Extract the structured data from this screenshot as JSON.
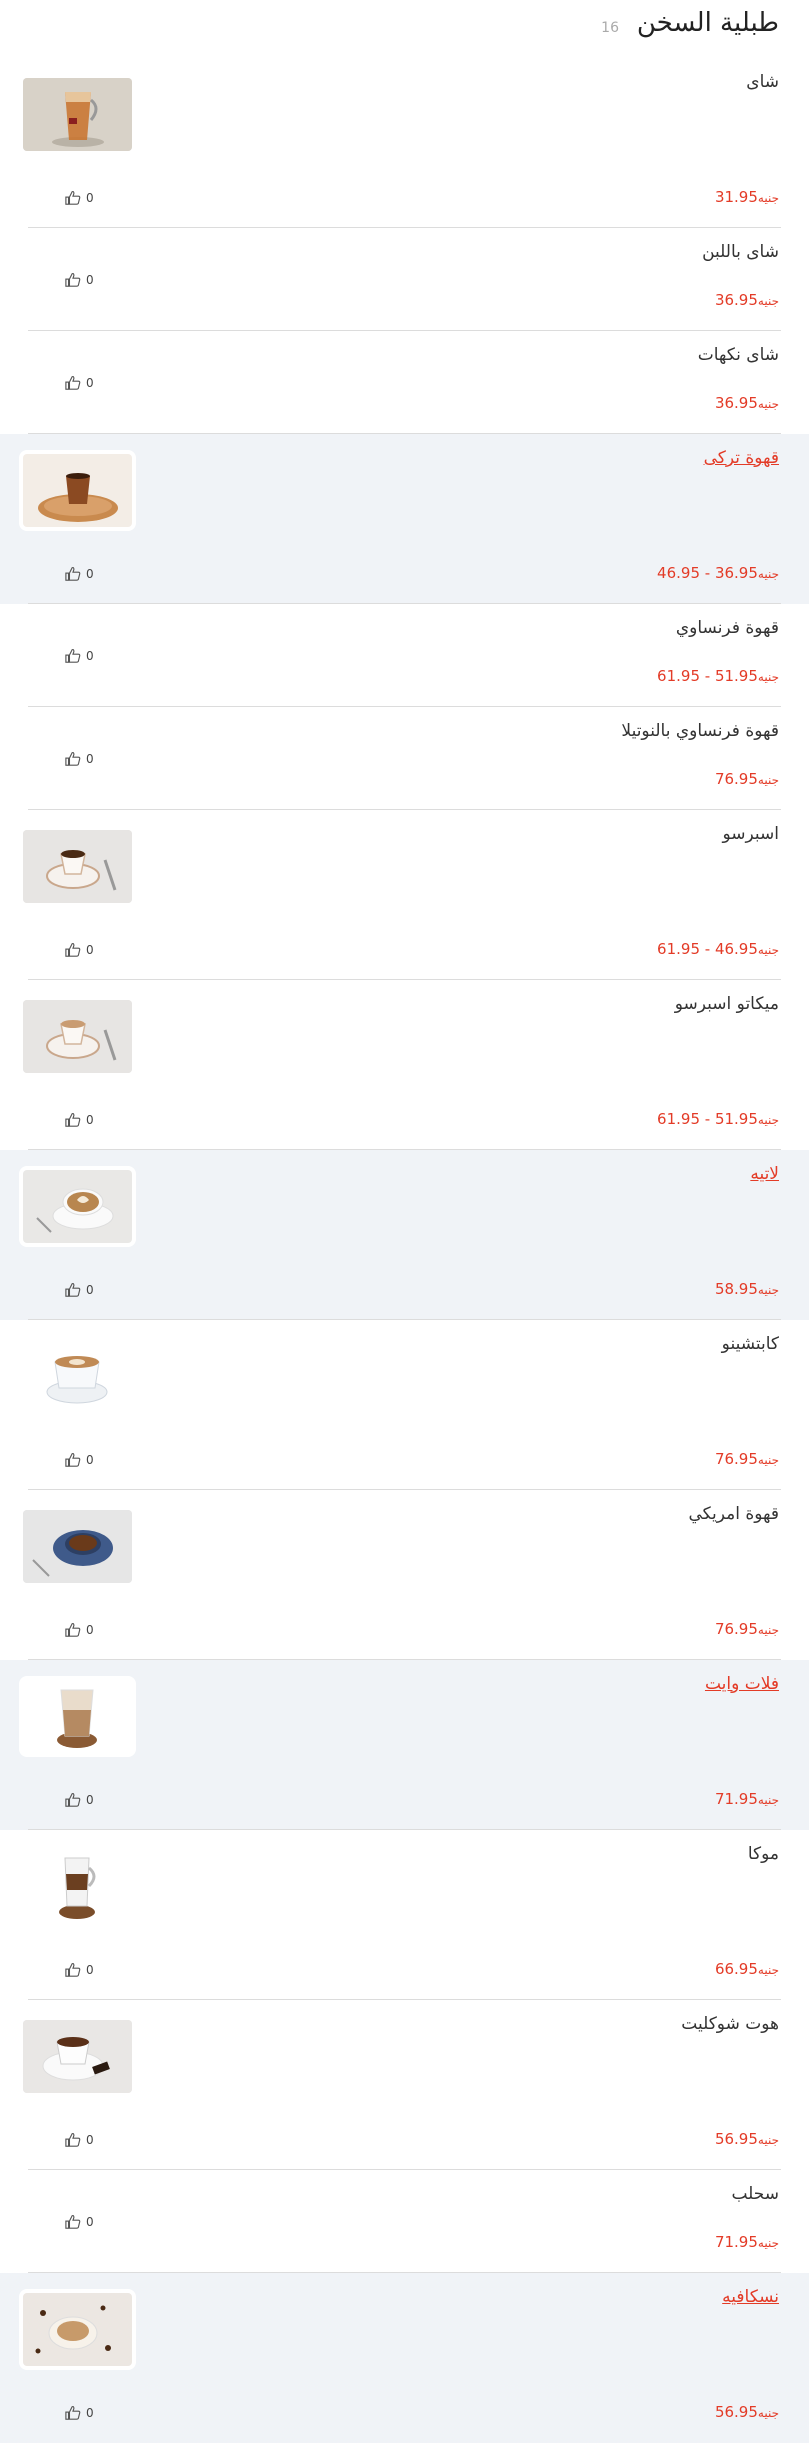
{
  "section": {
    "title": "طبلية السخن",
    "count": "16"
  },
  "currency": "جنيه",
  "items": [
    {
      "name": "شاى",
      "price": "31.95",
      "likes": "0",
      "image": "tea-glass",
      "highlight": false,
      "link": false
    },
    {
      "name": "شاى باللبن",
      "price": "36.95",
      "likes": "0",
      "image": null,
      "highlight": false,
      "link": false
    },
    {
      "name": "شاى نكهات",
      "price": "36.95",
      "likes": "0",
      "image": null,
      "highlight": false,
      "link": false
    },
    {
      "name": "قهوة تركى",
      "price": "36.95 - 46.95",
      "likes": "0",
      "image": "turkish-coffee",
      "highlight": true,
      "link": true
    },
    {
      "name": "قهوة فرنساوي",
      "price": "51.95 - 61.95",
      "likes": "0",
      "image": null,
      "highlight": false,
      "link": false
    },
    {
      "name": "قهوة فرنساوي بالنوتيلا",
      "price": "76.95",
      "likes": "0",
      "image": null,
      "highlight": false,
      "link": false
    },
    {
      "name": "اسبرسو",
      "price": "46.95 - 61.95",
      "likes": "0",
      "image": "espresso",
      "highlight": false,
      "link": false
    },
    {
      "name": "ميكاتو اسبرسو",
      "price": "51.95 - 61.95",
      "likes": "0",
      "image": "macchiato",
      "highlight": false,
      "link": false
    },
    {
      "name": "لاتيه",
      "price": "58.95",
      "likes": "0",
      "image": "latte",
      "highlight": true,
      "link": true
    },
    {
      "name": "كابتشينو",
      "price": "76.95",
      "likes": "0",
      "image": "cappuccino",
      "highlight": false,
      "link": false
    },
    {
      "name": "قهوة امريكي",
      "price": "76.95",
      "likes": "0",
      "image": "americano",
      "highlight": false,
      "link": false
    },
    {
      "name": "فلات وايت",
      "price": "71.95",
      "likes": "0",
      "image": "flat-white",
      "highlight": true,
      "link": true
    },
    {
      "name": "موكا",
      "price": "66.95",
      "likes": "0",
      "image": "mocha",
      "highlight": false,
      "link": false
    },
    {
      "name": "هوت شوكليت",
      "price": "56.95",
      "likes": "0",
      "image": "hot-chocolate",
      "highlight": false,
      "link": false
    },
    {
      "name": "سحلب",
      "price": "71.95",
      "likes": "0",
      "image": null,
      "highlight": false,
      "link": false
    },
    {
      "name": "نسكافيه",
      "price": "56.95",
      "likes": "0",
      "image": "nescafe",
      "highlight": true,
      "link": true
    }
  ],
  "colors": {
    "accent": "#e33b27",
    "highlight_bg": "#f0f3f7"
  }
}
